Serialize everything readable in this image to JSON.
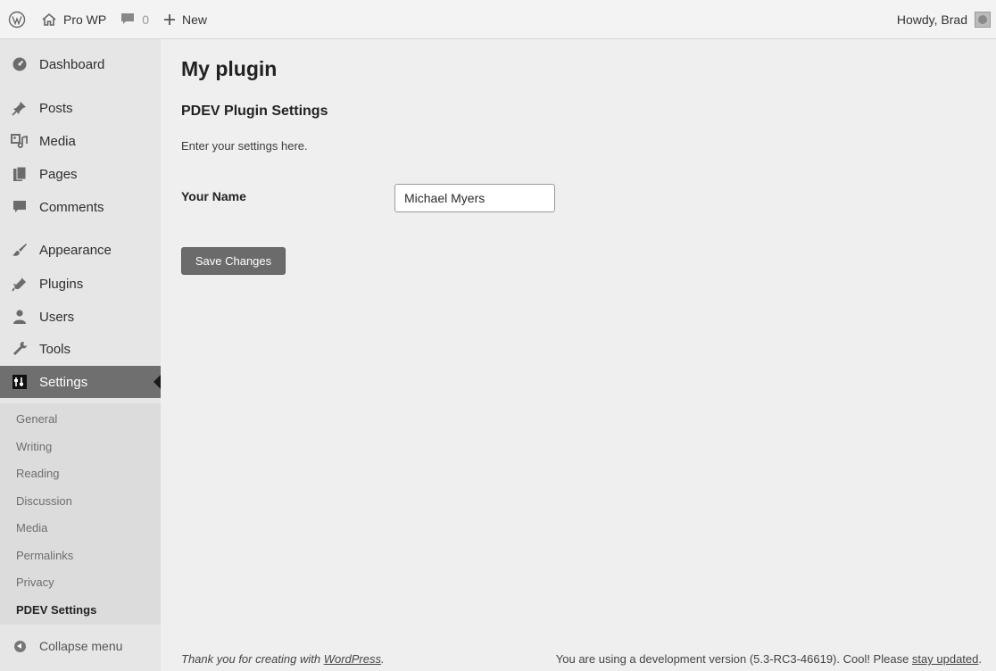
{
  "adminbar": {
    "site_name": "Pro WP",
    "comments_count": "0",
    "new_label": "New",
    "greeting": "Howdy, Brad"
  },
  "sidebar": {
    "items": [
      {
        "label": "Dashboard",
        "icon": "dashboard-icon"
      },
      {
        "label": "Posts",
        "icon": "pin-icon"
      },
      {
        "label": "Media",
        "icon": "media-icon"
      },
      {
        "label": "Pages",
        "icon": "pages-icon"
      },
      {
        "label": "Comments",
        "icon": "comment-icon"
      },
      {
        "label": "Appearance",
        "icon": "brush-icon"
      },
      {
        "label": "Plugins",
        "icon": "plug-icon"
      },
      {
        "label": "Users",
        "icon": "user-icon"
      },
      {
        "label": "Tools",
        "icon": "wrench-icon"
      },
      {
        "label": "Settings",
        "icon": "settings-icon"
      }
    ],
    "submenu": [
      "General",
      "Writing",
      "Reading",
      "Discussion",
      "Media",
      "Permalinks",
      "Privacy",
      "PDEV Settings"
    ],
    "collapse_label": "Collapse menu"
  },
  "main": {
    "page_title": "My plugin",
    "section_title": "PDEV Plugin Settings",
    "section_description": "Enter your settings here.",
    "field_label": "Your Name",
    "field_value": "Michael Myers",
    "save_label": "Save Changes"
  },
  "footer": {
    "left_prefix": "Thank you for creating with ",
    "left_link": "WordPress",
    "left_suffix": ".",
    "right_prefix": "You are using a development version (5.3-RC3-46619). Cool! Please ",
    "right_link": "stay updated",
    "right_suffix": "."
  },
  "colors": {
    "background": "#efefef",
    "sidebar": "#e6e6e6",
    "active_menu": "#6f6f6f",
    "button": "#6b6b6b"
  }
}
